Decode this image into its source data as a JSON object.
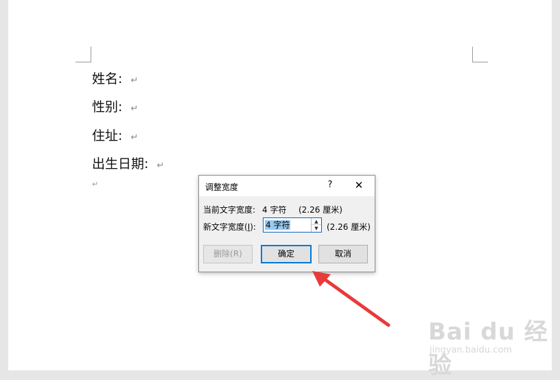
{
  "document": {
    "lines": [
      {
        "text": "姓名:"
      },
      {
        "text": "性别:"
      },
      {
        "text": "住址:"
      },
      {
        "text": "出生日期:"
      }
    ],
    "paragraph_mark": "↵"
  },
  "dialog": {
    "title": "调整宽度",
    "help_label": "?",
    "close_label": "✕",
    "current_width_label": "当前文字宽度:",
    "current_width_value": "4 字符",
    "current_width_cm": "(2.26 厘米)",
    "new_width_label_pre": "新文字宽度(",
    "new_width_label_key": "I",
    "new_width_label_post": "):",
    "new_width_value": "4 字符",
    "new_width_cm": "(2.26 厘米)",
    "spin_up_icon": "▲",
    "spin_down_icon": "▼",
    "buttons": {
      "delete": "删除(R)",
      "ok": "确定",
      "cancel": "取消"
    }
  },
  "annotation": {
    "arrow_color": "#e83a3a"
  },
  "watermark": {
    "logo": "Bai du 经验",
    "url": "jingyan.baidu.com"
  }
}
